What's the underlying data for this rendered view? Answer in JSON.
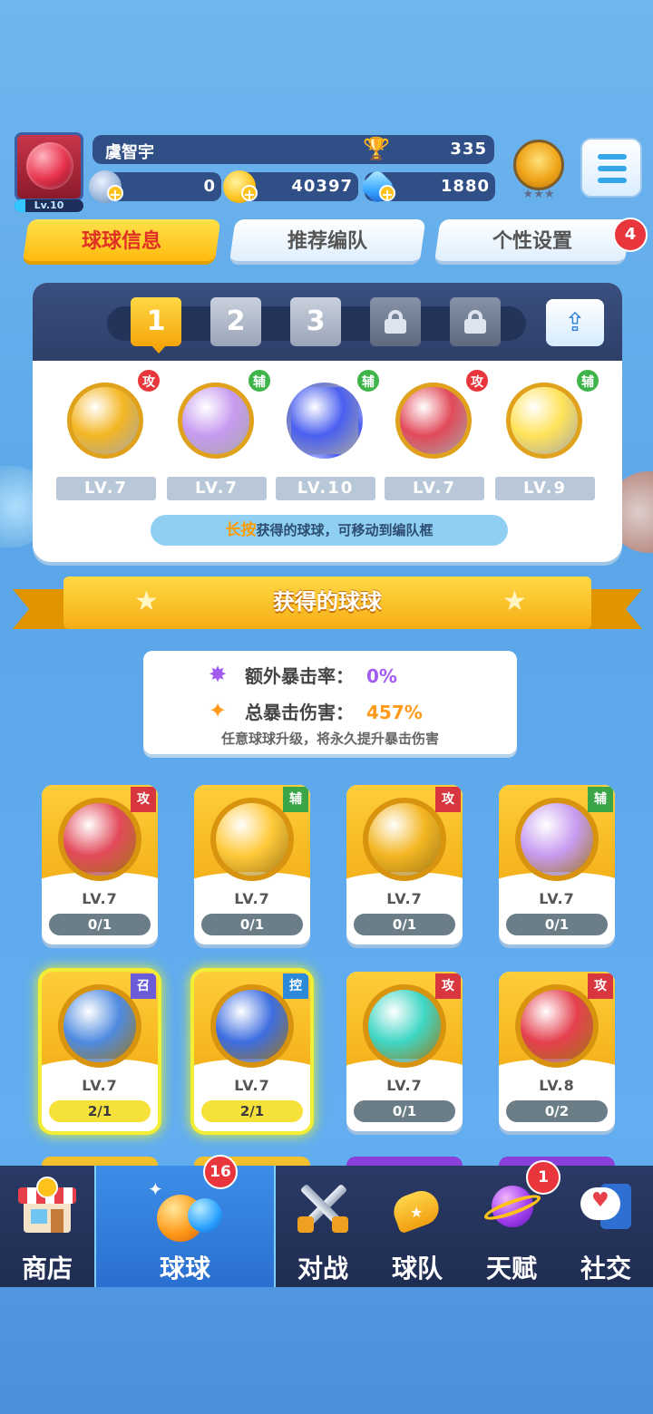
{
  "header": {
    "player_name": "虞智宇",
    "level_label": "Lv.10",
    "trophies": "335",
    "silver": "0",
    "gold": "40397",
    "gems": "1880"
  },
  "tabs": [
    {
      "label": "球球信息",
      "active": true
    },
    {
      "label": "推荐编队",
      "active": false
    },
    {
      "label": "个性设置",
      "active": false,
      "badge": "4"
    }
  ],
  "team": {
    "slots": [
      "1",
      "2",
      "3"
    ],
    "balls": [
      {
        "level": "LV.7",
        "tag": "攻",
        "tag_type": "atk",
        "color": "#f4b623"
      },
      {
        "level": "LV.7",
        "tag": "辅",
        "tag_type": "sup",
        "color": "#c79bf0"
      },
      {
        "level": "LV.10",
        "tag": "辅",
        "tag_type": "sup",
        "color": "#4a5ff0"
      },
      {
        "level": "LV.7",
        "tag": "攻",
        "tag_type": "atk",
        "color": "#e24a5a"
      },
      {
        "level": "LV.9",
        "tag": "辅",
        "tag_type": "sup",
        "color": "#ffe35a"
      }
    ],
    "hint_highlight": "长按",
    "hint_text": "获得的球球，可移动到编队框"
  },
  "section_title": "获得的球球",
  "crit": {
    "extra_label": "额外暴击率：",
    "extra_value": "0%",
    "total_label": "总暴击伤害：",
    "total_value": "457%",
    "note": "任意球球升级，将永久提升暴击伤害"
  },
  "cards": [
    {
      "level": "LV.7",
      "progress": "0/1",
      "tag": "攻",
      "tag_type": "atk",
      "color": "#e24a5a",
      "glow": false,
      "full": false
    },
    {
      "level": "LV.7",
      "progress": "0/1",
      "tag": "辅",
      "tag_type": "sup",
      "color": "#ffc93a",
      "glow": false,
      "full": false
    },
    {
      "level": "LV.7",
      "progress": "0/1",
      "tag": "攻",
      "tag_type": "atk",
      "color": "#f4b623",
      "glow": false,
      "full": false
    },
    {
      "level": "LV.7",
      "progress": "0/1",
      "tag": "辅",
      "tag_type": "sup",
      "color": "#c79bf0",
      "glow": false,
      "full": false
    },
    {
      "level": "LV.7",
      "progress": "2/1",
      "tag": "召",
      "tag_type": "sum",
      "color": "#4f8be0",
      "glow": true,
      "full": true
    },
    {
      "level": "LV.7",
      "progress": "2/1",
      "tag": "控",
      "tag_type": "ctl",
      "color": "#3d6de0",
      "glow": true,
      "full": true
    },
    {
      "level": "LV.7",
      "progress": "0/1",
      "tag": "攻",
      "tag_type": "atk",
      "color": "#3fd6c4",
      "glow": false,
      "full": false
    },
    {
      "level": "LV.8",
      "progress": "0/2",
      "tag": "攻",
      "tag_type": "atk",
      "color": "#e5404e",
      "glow": false,
      "full": false
    }
  ],
  "nav": [
    {
      "label": "商店",
      "active": false
    },
    {
      "label": "球球",
      "active": true,
      "badge": "16"
    },
    {
      "label": "对战",
      "active": false
    },
    {
      "label": "球队",
      "active": false
    },
    {
      "label": "天赋",
      "active": false,
      "badge": "1"
    },
    {
      "label": "社交",
      "active": false
    }
  ]
}
